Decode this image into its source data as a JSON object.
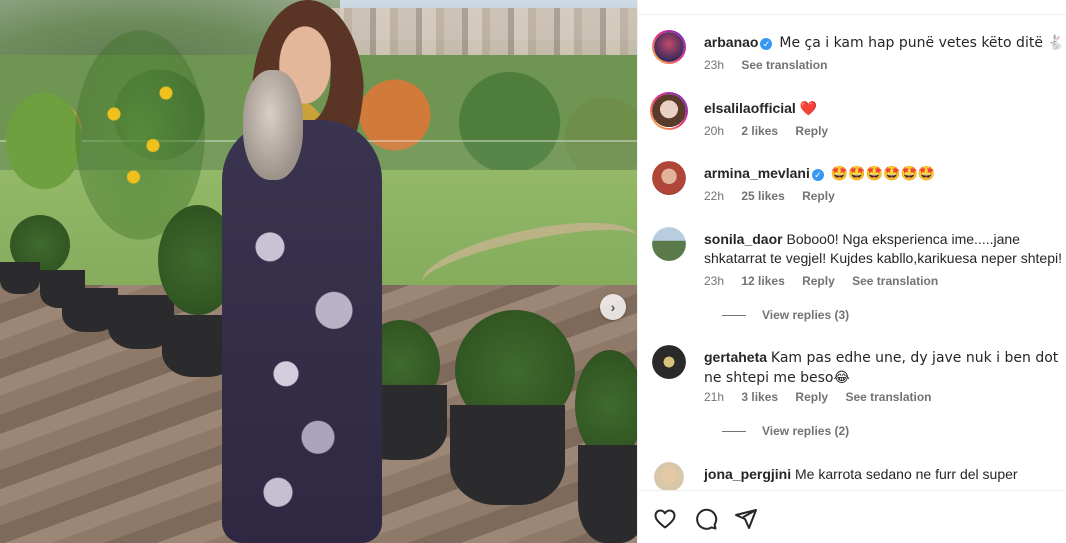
{
  "photo": {
    "next_icon": "chevron-right-icon",
    "next_symbol": "›"
  },
  "comments": [
    {
      "username": "arbanao",
      "verified": true,
      "text": "Me ça i kam hap punë vetes këto ditë 🐇",
      "time": "23h",
      "likes": "",
      "reply": "",
      "translation": "See translation",
      "avatar_color": "#3b2a5a"
    },
    {
      "username": "elsalilaofficial",
      "verified": false,
      "text": "❤️",
      "time": "20h",
      "likes": "2 likes",
      "reply": "Reply",
      "translation": "",
      "avatar_color": "#8a6a5a"
    },
    {
      "username": "armina_mevlani",
      "verified": true,
      "text": "🤩🤩🤩🤩🤩🤩",
      "time": "22h",
      "likes": "25 likes",
      "reply": "Reply",
      "translation": "",
      "avatar_color": "#b0463a"
    },
    {
      "username": "sonila_daor",
      "verified": false,
      "text": "Boboo0! Nga eksperienca ime.....jane shkatarrat te vegjel! Kujdes kabllo,karikuesa neper shtepi!",
      "time": "23h",
      "likes": "12 likes",
      "reply": "Reply",
      "translation": "See translation",
      "view_replies": "View replies (3)",
      "avatar_color": "#5a7a4a"
    },
    {
      "username": "gertaheta",
      "verified": false,
      "text": "Kam pas edhe une, dy jave nuk i ben dot ne shtepi me beso😂",
      "time": "21h",
      "likes": "3 likes",
      "reply": "Reply",
      "translation": "See translation",
      "view_replies": "View replies (2)",
      "avatar_color": "#2a2a2a"
    },
    {
      "username": "jona_pergjini",
      "verified": false,
      "text": "Me karrota sedano ne furr del super",
      "time": "",
      "likes": "",
      "reply": "",
      "translation": "",
      "avatar_color": "#d8c7a8"
    }
  ],
  "actions": {
    "like_icon": "heart-icon",
    "comment_icon": "comment-icon",
    "share_icon": "share-icon"
  }
}
